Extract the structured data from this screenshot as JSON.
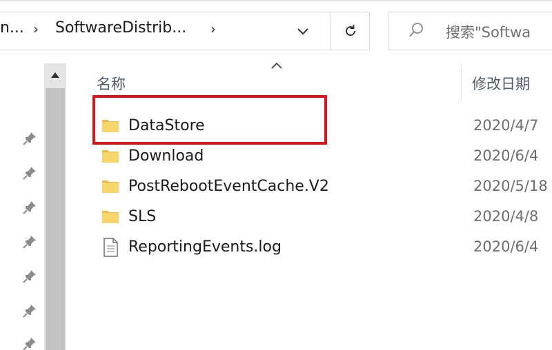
{
  "address_bar": {
    "prefix": "n...",
    "separator": "›",
    "path": "SoftwareDistrib...",
    "separator2": "›"
  },
  "search": {
    "placeholder": "搜索\"Softwa"
  },
  "file_list": {
    "columns": {
      "name": "名称",
      "date_modified": "修改日期"
    },
    "items": [
      {
        "name": "DataStore",
        "date": "2020/4/7",
        "type": "folder"
      },
      {
        "name": "Download",
        "date": "2020/6/4",
        "type": "folder"
      },
      {
        "name": "PostRebootEventCache.V2",
        "date": "2020/5/18",
        "type": "folder"
      },
      {
        "name": "SLS",
        "date": "2020/4/8",
        "type": "folder"
      },
      {
        "name": "ReportingEvents.log",
        "date": "2020/6/4",
        "type": "file"
      }
    ]
  },
  "colors": {
    "highlight": "#d0191c",
    "folder": "#f6d56a",
    "scrollbar_thumb": "#c2c2c2"
  },
  "icons": {
    "dropdown": "chevron-down-icon",
    "refresh": "refresh-icon",
    "search": "search-icon",
    "sort": "chevron-up-icon",
    "folder": "folder-icon",
    "file": "document-icon",
    "pin": "pin-icon"
  }
}
